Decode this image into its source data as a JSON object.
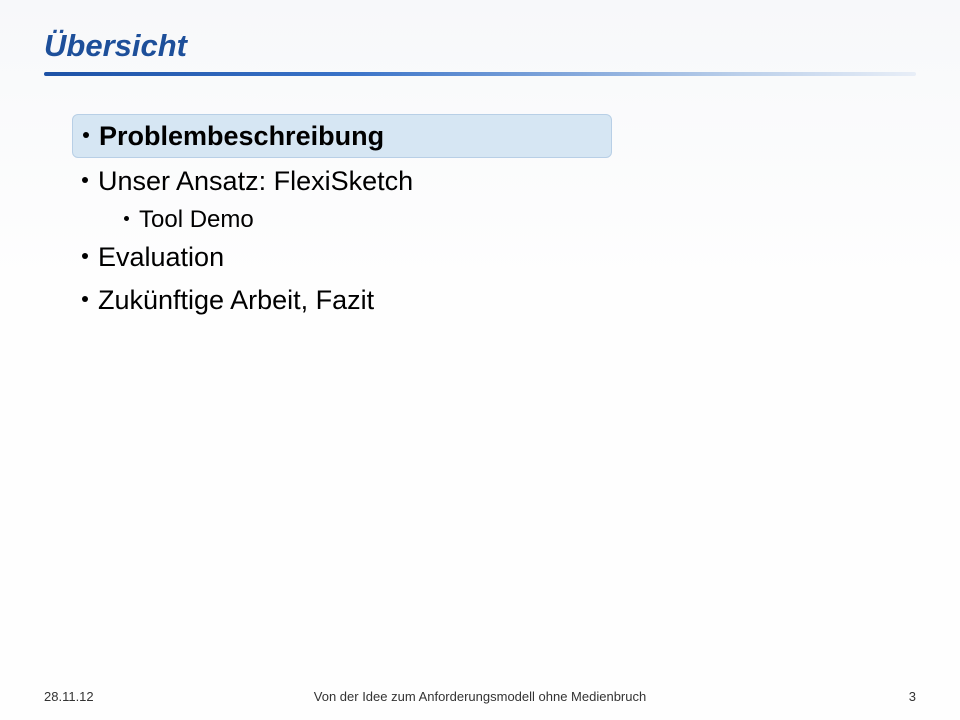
{
  "title": "Übersicht",
  "bullets": {
    "b1": "Problembeschreibung",
    "b2": "Unser Ansatz: FlexiSketch",
    "b2a": "Tool Demo",
    "b3": "Evaluation",
    "b4": "Zukünftige Arbeit, Fazit"
  },
  "footer": {
    "date": "28.11.12",
    "caption": "Von der Idee zum Anforderungsmodell ohne Medienbruch",
    "page": "3"
  }
}
